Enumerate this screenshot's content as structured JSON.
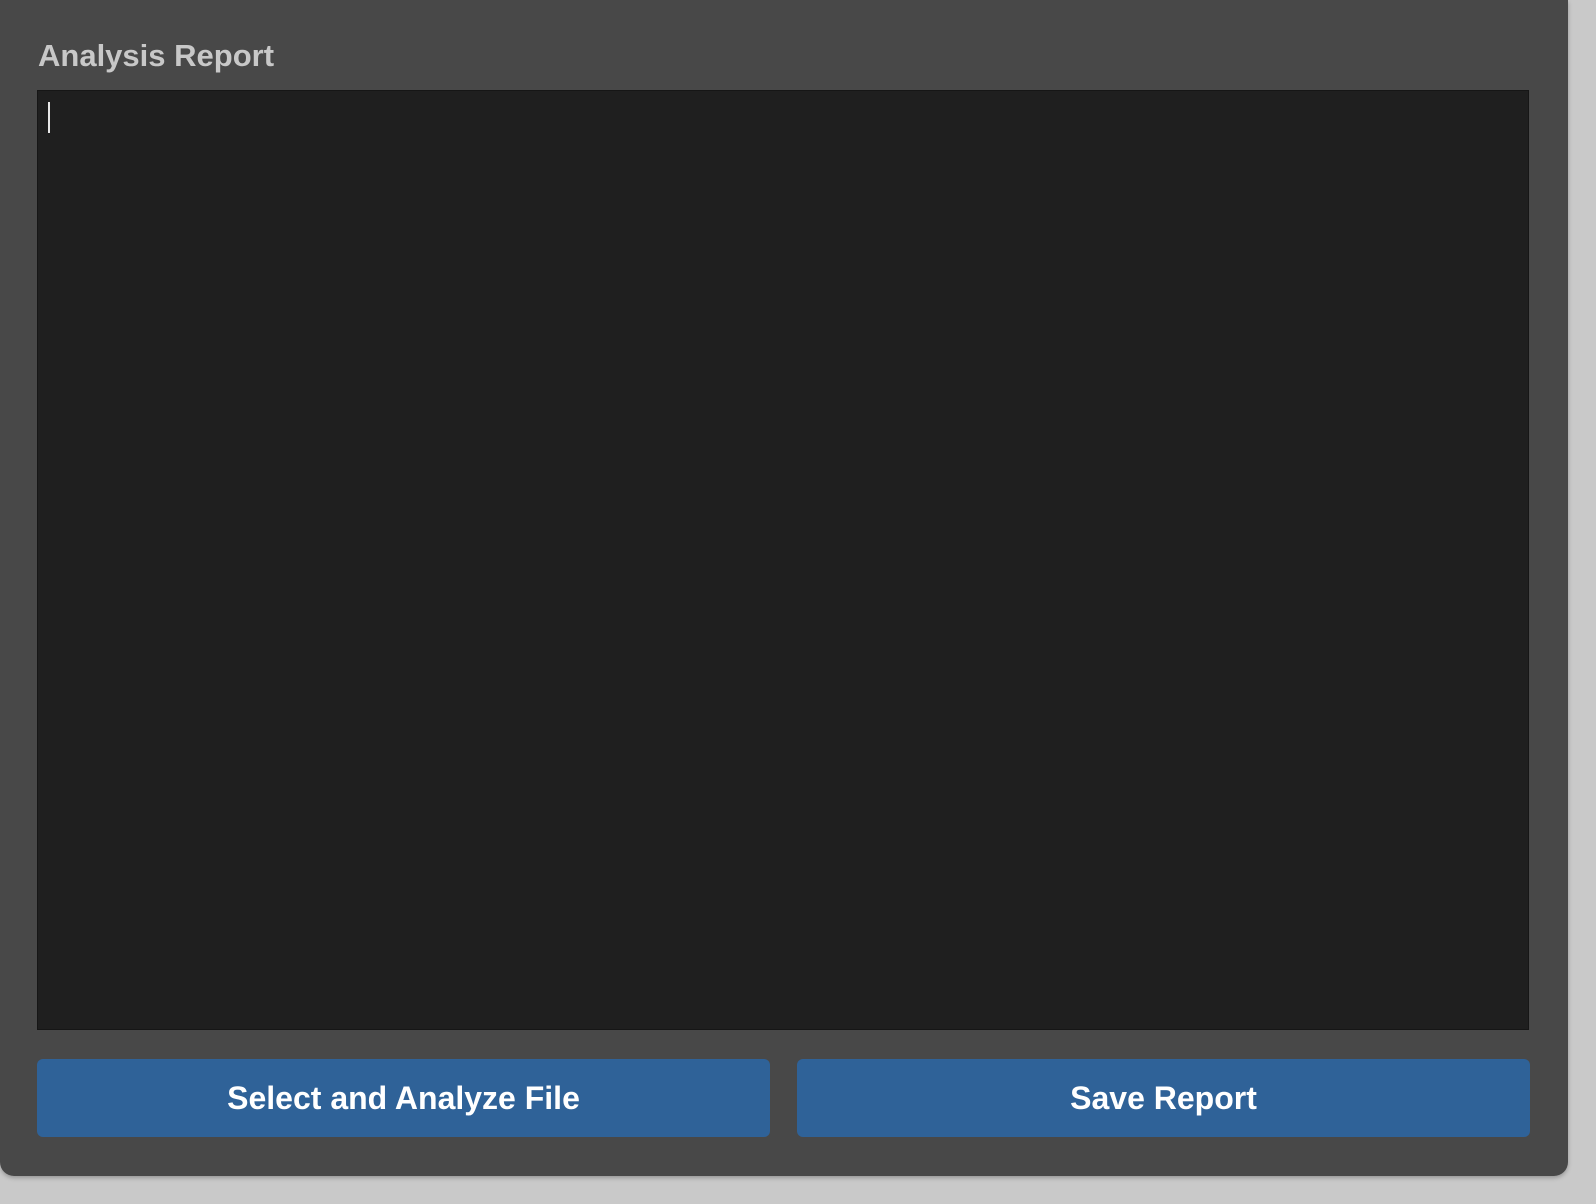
{
  "header": {
    "title": "Analysis Report"
  },
  "report": {
    "text": ""
  },
  "actions": {
    "analyze_label": "Select and Analyze File",
    "save_label": "Save Report"
  },
  "colors": {
    "window_bg": "#484848",
    "report_bg": "#1f1f1f",
    "button_bg": "#2f6298",
    "title_text": "#c8c8c8",
    "button_text": "#ffffff"
  }
}
